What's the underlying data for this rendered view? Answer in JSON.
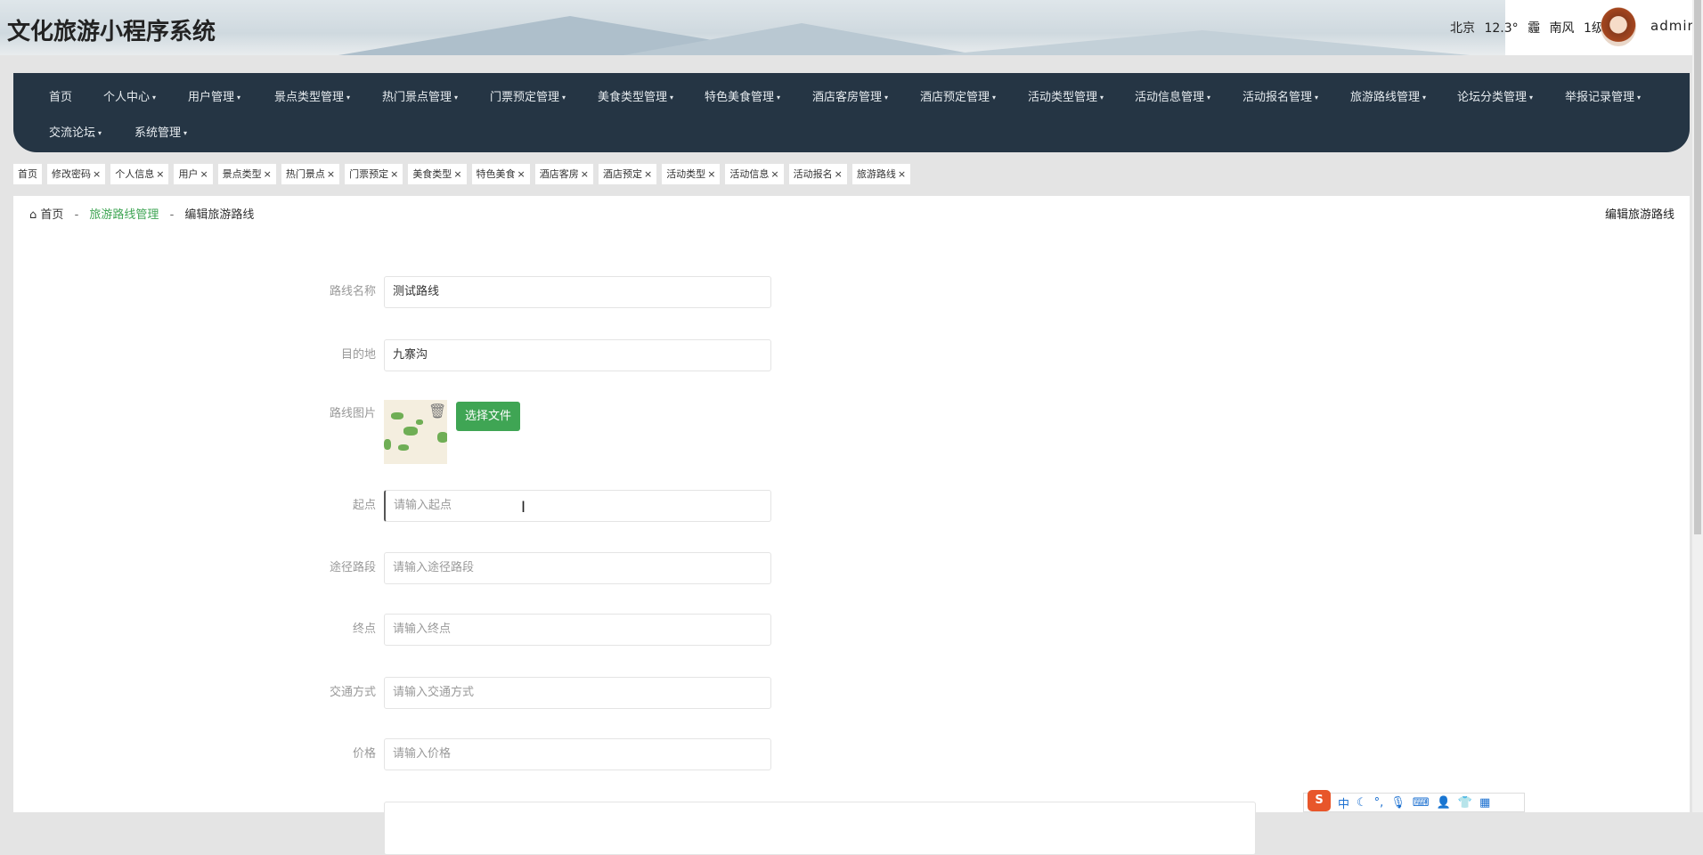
{
  "header": {
    "title": "文化旅游小程序系统",
    "weather": {
      "city": "北京",
      "temp": "12.3°",
      "condition": "霾",
      "wind": "南风",
      "level": "1级"
    },
    "user": "admin"
  },
  "nav": {
    "items": [
      {
        "label": "首页",
        "dropdown": false
      },
      {
        "label": "个人中心",
        "dropdown": true
      },
      {
        "label": "用户管理",
        "dropdown": true
      },
      {
        "label": "景点类型管理",
        "dropdown": true
      },
      {
        "label": "热门景点管理",
        "dropdown": true
      },
      {
        "label": "门票预定管理",
        "dropdown": true
      },
      {
        "label": "美食类型管理",
        "dropdown": true
      },
      {
        "label": "特色美食管理",
        "dropdown": true
      },
      {
        "label": "酒店客房管理",
        "dropdown": true
      },
      {
        "label": "酒店预定管理",
        "dropdown": true
      },
      {
        "label": "活动类型管理",
        "dropdown": true
      },
      {
        "label": "活动信息管理",
        "dropdown": true
      },
      {
        "label": "活动报名管理",
        "dropdown": true
      },
      {
        "label": "旅游路线管理",
        "dropdown": true
      },
      {
        "label": "论坛分类管理",
        "dropdown": true
      },
      {
        "label": "举报记录管理",
        "dropdown": true
      },
      {
        "label": "交流论坛",
        "dropdown": true
      },
      {
        "label": "系统管理",
        "dropdown": true
      }
    ],
    "dropdown_glyph": "▾"
  },
  "tags": [
    "首页",
    "修改密码",
    "个人信息",
    "用户",
    "景点类型",
    "热门景点",
    "门票预定",
    "美食类型",
    "特色美食",
    "酒店客房",
    "酒店预定",
    "活动类型",
    "活动信息",
    "活动报名",
    "旅游路线"
  ],
  "tag_close": "×",
  "breadcrumb": {
    "home": "首页",
    "section": "旅游路线管理",
    "current": "编辑旅游路线",
    "sep": "-"
  },
  "page_title": "编辑旅游路线",
  "form": {
    "name": {
      "label": "路线名称",
      "value": "测试路线"
    },
    "destination": {
      "label": "目的地",
      "value": "九寨沟"
    },
    "image": {
      "label": "路线图片",
      "button": "选择文件"
    },
    "start": {
      "label": "起点",
      "placeholder": "请输入起点"
    },
    "via": {
      "label": "途径路段",
      "placeholder": "请输入途径路段"
    },
    "end": {
      "label": "终点",
      "placeholder": "请输入终点"
    },
    "transport": {
      "label": "交通方式",
      "placeholder": "请输入交通方式"
    },
    "price": {
      "label": "价格",
      "placeholder": "请输入价格"
    }
  },
  "ime": {
    "logo": "S",
    "mode": "中"
  },
  "colors": {
    "nav_bg": "#253544",
    "accent": "#3fa554"
  }
}
